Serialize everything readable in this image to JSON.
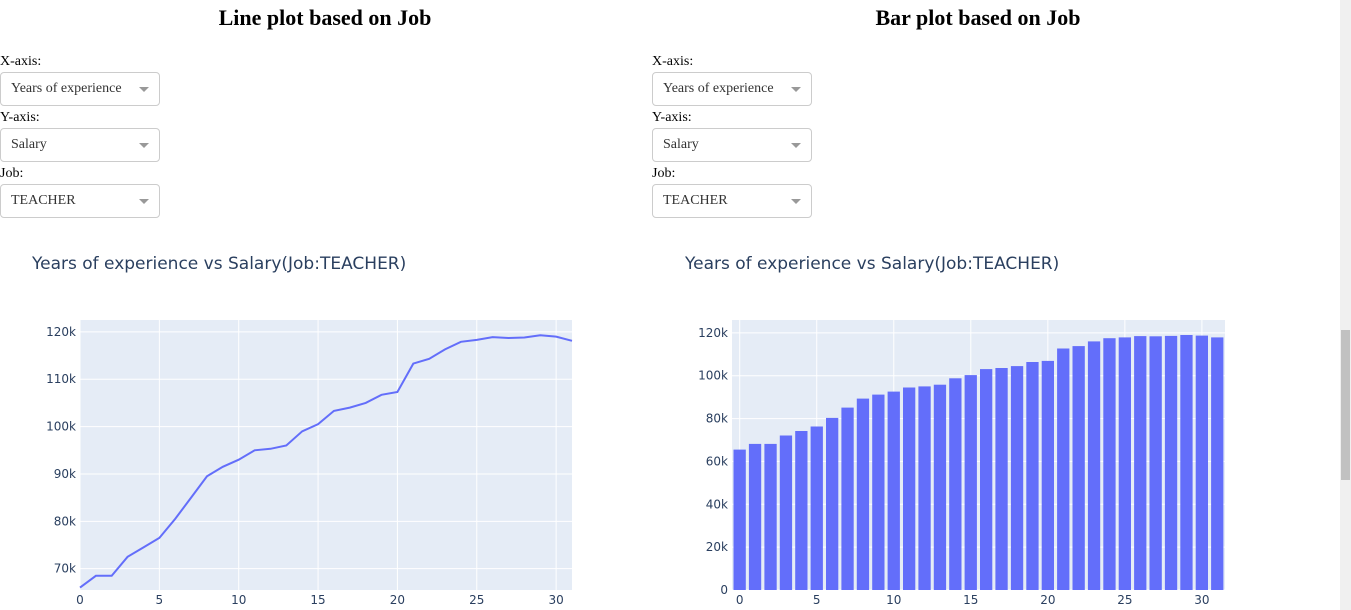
{
  "left_panel": {
    "title": "Line plot based on Job",
    "x_label": "X-axis:",
    "x_value": "Years of experience",
    "y_label": "Y-axis:",
    "y_value": "Salary",
    "job_label": "Job:",
    "job_value": "TEACHER",
    "chart_title": "Years of experience vs Salary(Job:TEACHER)"
  },
  "right_panel": {
    "title": "Bar plot based on Job",
    "x_label": "X-axis:",
    "x_value": "Years of experience",
    "y_label": "Y-axis:",
    "y_value": "Salary",
    "job_label": "Job:",
    "job_value": "TEACHER",
    "chart_title": "Years of experience vs Salary(Job:TEACHER)"
  },
  "colors": {
    "series": "#636efa",
    "plot_bg": "#e5ecf6",
    "grid": "#ffffff",
    "tick_text": "#2a3f5f"
  },
  "chart_data": [
    {
      "type": "line",
      "title": "Years of experience vs Salary(Job:TEACHER)",
      "x": [
        0,
        1,
        2,
        3,
        4,
        5,
        6,
        7,
        8,
        9,
        10,
        11,
        12,
        13,
        14,
        15,
        16,
        17,
        18,
        19,
        20,
        21,
        22,
        23,
        24,
        25,
        26,
        27,
        28,
        29,
        30,
        31
      ],
      "values": [
        66000,
        68500,
        68500,
        72500,
        74500,
        76500,
        80500,
        85000,
        89500,
        91500,
        93000,
        95000,
        95300,
        96000,
        99000,
        100500,
        103300,
        104000,
        105000,
        106700,
        107300,
        113300,
        114300,
        116300,
        117900,
        118300,
        118900,
        118700,
        118800,
        119300,
        119000,
        118100
      ],
      "xlim": [
        0,
        31
      ],
      "ylim": [
        65500,
        122500
      ],
      "x_ticks": [
        0,
        5,
        10,
        15,
        20,
        25,
        30
      ],
      "y_ticks": [
        70000,
        80000,
        90000,
        100000,
        110000,
        120000
      ],
      "y_tick_labels": [
        "70k",
        "80k",
        "90k",
        "100k",
        "110k",
        "120k"
      ]
    },
    {
      "type": "bar",
      "title": "Years of experience vs Salary(Job:TEACHER)",
      "x": [
        0,
        1,
        2,
        3,
        4,
        5,
        6,
        7,
        8,
        9,
        10,
        11,
        12,
        13,
        14,
        15,
        16,
        17,
        18,
        19,
        20,
        21,
        22,
        23,
        24,
        25,
        26,
        27,
        28,
        29,
        30,
        31
      ],
      "values": [
        65500,
        68200,
        68200,
        72100,
        74200,
        76300,
        80300,
        85100,
        89300,
        91200,
        92600,
        94500,
        95000,
        95800,
        98800,
        100300,
        103100,
        103600,
        104500,
        106400,
        106900,
        112700,
        113800,
        116000,
        117500,
        117900,
        118500,
        118400,
        118600,
        119000,
        118700,
        117900
      ],
      "xlim": [
        -0.5,
        31.5
      ],
      "ylim": [
        0,
        126000
      ],
      "x_ticks": [
        0,
        5,
        10,
        15,
        20,
        25,
        30
      ],
      "y_ticks": [
        0,
        20000,
        40000,
        60000,
        80000,
        100000,
        120000
      ],
      "y_tick_labels": [
        "0",
        "20k",
        "40k",
        "60k",
        "80k",
        "100k",
        "120k"
      ]
    }
  ]
}
